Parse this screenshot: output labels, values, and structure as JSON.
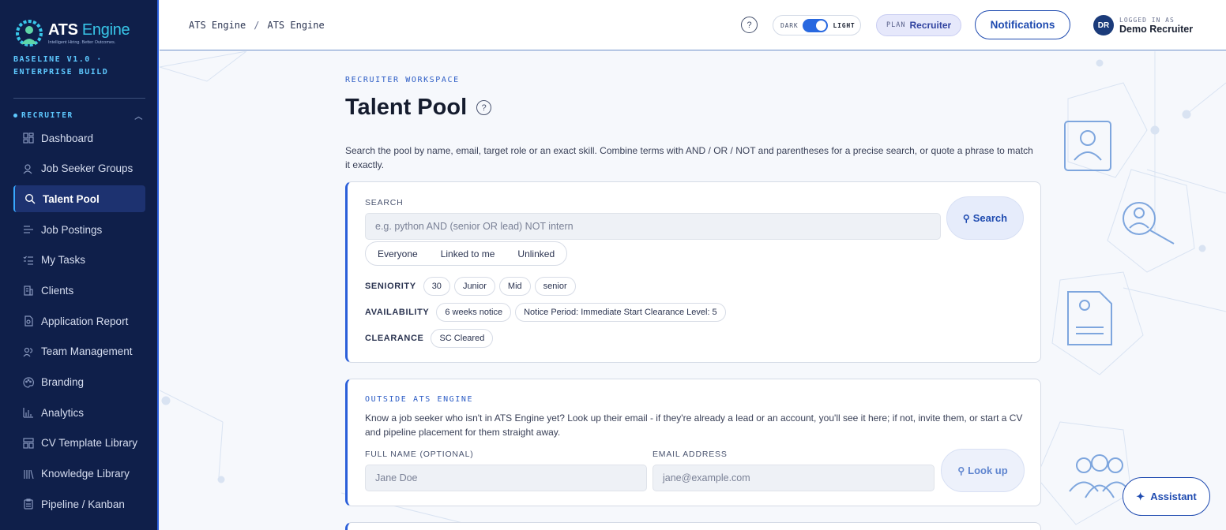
{
  "brand": {
    "name_a": "ATS",
    "name_b": " Engine",
    "tagline": "Intelligent Hiring. Better Outcomes.",
    "build_line1": "BASELINE V1.0 ·",
    "build_line2": "ENTERPRISE BUILD"
  },
  "sidebar": {
    "section": "RECRUITER",
    "items": [
      {
        "label": "Dashboard",
        "icon": "dashboard-icon",
        "active": false
      },
      {
        "label": "Job Seeker Groups",
        "icon": "users-icon",
        "active": false
      },
      {
        "label": "Talent Pool",
        "icon": "search-icon",
        "active": true
      },
      {
        "label": "Job Postings",
        "icon": "list-icon",
        "active": false
      },
      {
        "label": "My Tasks",
        "icon": "tasks-icon",
        "active": false
      },
      {
        "label": "Clients",
        "icon": "building-icon",
        "active": false
      },
      {
        "label": "Application Report",
        "icon": "report-icon",
        "active": false
      },
      {
        "label": "Team Management",
        "icon": "team-icon",
        "active": false
      },
      {
        "label": "Branding",
        "icon": "palette-icon",
        "active": false
      },
      {
        "label": "Analytics",
        "icon": "bar-chart-icon",
        "active": false
      },
      {
        "label": "CV Template Library",
        "icon": "template-icon",
        "active": false
      },
      {
        "label": "Knowledge Library",
        "icon": "library-icon",
        "active": false
      },
      {
        "label": "Pipeline / Kanban",
        "icon": "clipboard-icon",
        "active": false
      }
    ]
  },
  "header": {
    "crumb_1": "ATS Engine",
    "crumb_sep": "/",
    "crumb_2": "ATS Engine",
    "help": "?",
    "theme_dark": "DARK",
    "theme_light": "LIGHT",
    "plan_label": "PLAN",
    "plan_value": "Recruiter",
    "notifications": "Notifications",
    "avatar": "DR",
    "logged_in_label": "LOGGED IN AS",
    "user_name": "Demo Recruiter"
  },
  "main": {
    "eyebrow": "RECRUITER WORKSPACE",
    "title": "Talent Pool",
    "intro": "Search the pool by name, email, target role or an exact skill. Combine terms with AND / OR / NOT and parentheses for a precise search, or quote a phrase to match it exactly."
  },
  "search_card": {
    "label": "SEARCH",
    "placeholder": "e.g. python AND (senior OR lead) NOT intern",
    "button": "Search",
    "scope": [
      "Everyone",
      "Linked to me",
      "Unlinked"
    ],
    "seniority_label": "SENIORITY",
    "seniority": [
      "30",
      "Junior",
      "Mid",
      "senior"
    ],
    "availability_label": "AVAILABILITY",
    "availability": [
      "6 weeks notice",
      "Notice Period: Immediate Start Clearance Level: 5"
    ],
    "clearance_label": "CLEARANCE",
    "clearance": [
      "SC Cleared"
    ]
  },
  "outside_card": {
    "eyebrow": "OUTSIDE ATS ENGINE",
    "text": "Know a job seeker who isn't in ATS Engine yet? Look up their email - if they're already a lead or an account, you'll see it here; if not, invite them, or start a CV and pipeline placement for them straight away.",
    "name_label": "FULL NAME (OPTIONAL)",
    "name_placeholder": "Jane Doe",
    "email_label": "EMAIL ADDRESS",
    "email_placeholder": "jane@example.com",
    "button": "Look up"
  },
  "assistant": {
    "label": "Assistant",
    "icon": "sparkle-icon"
  },
  "colors": {
    "sidebar_bg": "#0f1f4a",
    "accent": "#2b5fd9",
    "brand_cyan": "#38c6e8"
  }
}
